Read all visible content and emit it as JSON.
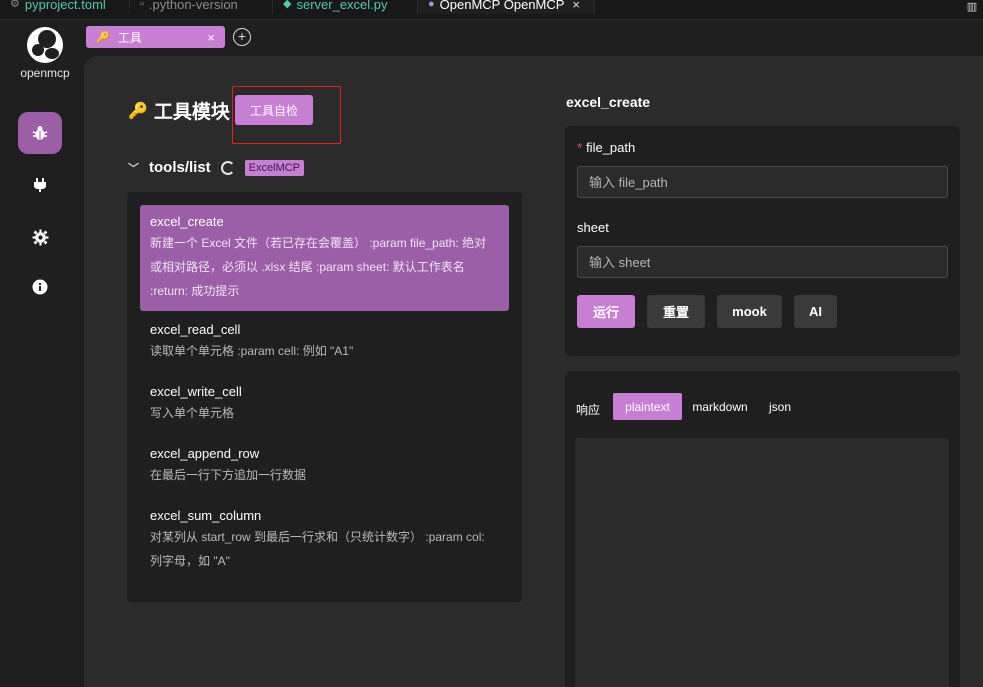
{
  "editor_tabs": [
    {
      "label": "pyproject.toml",
      "icon": "gear-icon"
    },
    {
      "label": ".python-version",
      "icon": "file-icon"
    },
    {
      "label": "server_excel.py",
      "icon": "python-icon"
    },
    {
      "label": "OpenMCP OpenMCP",
      "icon": "openmcp-icon",
      "close": "×"
    }
  ],
  "sidebar": {
    "logo_text": "openmcp",
    "items": [
      {
        "name": "debug",
        "icon": "bug-icon",
        "active": true
      },
      {
        "name": "connect",
        "icon": "plug-icon"
      },
      {
        "name": "settings",
        "icon": "gear-icon"
      },
      {
        "name": "about",
        "icon": "info-icon"
      }
    ]
  },
  "app_tabs": [
    {
      "label": "工具",
      "icon": "key-icon",
      "close": "×"
    }
  ],
  "add_tab": "+",
  "module": {
    "title": "工具模块",
    "self_check_label": "工具自检"
  },
  "tools": {
    "header": "tools/list",
    "server_badge": "ExcelMCP",
    "items": [
      {
        "name": "excel_create",
        "desc_lines": [
          "新建一个 Excel 文件（若已存在会覆盖） :param file_path: 绝对",
          "或相对路径，必须以 .xlsx 结尾 :param sheet: 默认工作表名",
          ":return: 成功提示"
        ],
        "active": true
      },
      {
        "name": "excel_read_cell",
        "desc_lines": [
          "读取单个单元格 :param cell: 例如 \"A1\""
        ]
      },
      {
        "name": "excel_write_cell",
        "desc_lines": [
          "写入单个单元格"
        ]
      },
      {
        "name": "excel_append_row",
        "desc_lines": [
          "在最后一行下方追加一行数据"
        ]
      },
      {
        "name": "excel_sum_column",
        "desc_lines": [
          "对某列从 start_row 到最后一行求和（只统计数字） :param col:",
          "列字母，如 \"A\""
        ]
      }
    ]
  },
  "form": {
    "title": "excel_create",
    "required_mark": "*",
    "fields": [
      {
        "label": "file_path",
        "placeholder": "输入 file_path",
        "required": true
      },
      {
        "label": "sheet",
        "placeholder": "输入 sheet",
        "required": false
      }
    ],
    "buttons": {
      "run": "运行",
      "reset": "重置",
      "mook": "mook",
      "ai": "AI"
    }
  },
  "response": {
    "label": "响应",
    "tabs": [
      "plaintext",
      "markdown",
      "json"
    ],
    "active_tab": "plaintext"
  },
  "colors": {
    "accent": "#c77fd4",
    "accent_dark": "#9a5fa6",
    "highlight_box": "#e02020"
  }
}
